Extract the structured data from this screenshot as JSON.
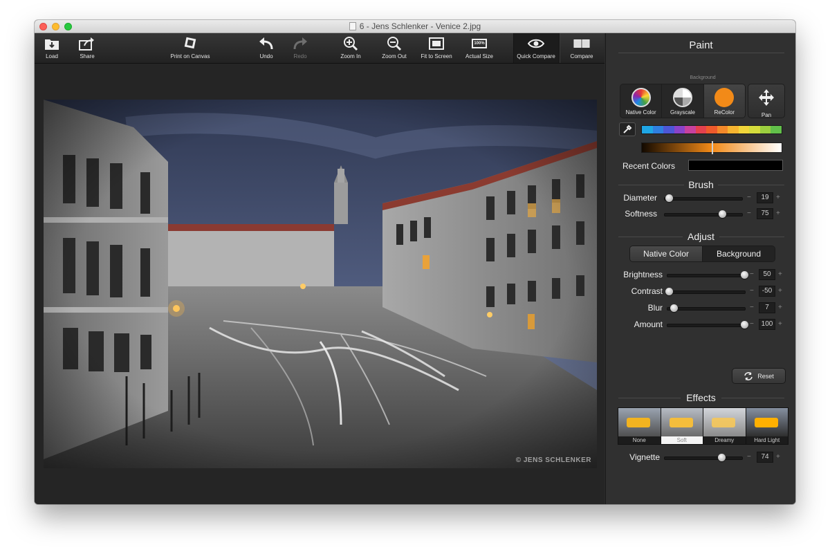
{
  "window": {
    "title": "6 - Jens Schlenker - Venice 2.jpg"
  },
  "toolbar": {
    "load": "Load",
    "share": "Share",
    "print_on_canvas": "Print on Canvas",
    "undo": "Undo",
    "redo": "Redo",
    "zoom_in": "Zoom In",
    "zoom_out": "Zoom Out",
    "fit_to_screen": "Fit to Screen",
    "actual_size": "Actual Size",
    "actual_size_badge": "100%",
    "quick_compare": "Quick Compare",
    "compare": "Compare"
  },
  "photo": {
    "watermark": "© JENS SCHLENKER"
  },
  "paint": {
    "title": "Paint",
    "background_caption": "Background",
    "modes": {
      "native_color": "Native Color",
      "grayscale": "Grayscale",
      "recolor": "ReColor",
      "pan": "Pan"
    },
    "active_mode": "recolor",
    "recolor_color": "#f28a18",
    "swatch_colors": [
      "#1fa6e5",
      "#2f7fe0",
      "#4d57d6",
      "#8a43c9",
      "#c7419e",
      "#e3414e",
      "#ee5a2c",
      "#f3892a",
      "#f6b430",
      "#f1d53a",
      "#d5dc3c",
      "#9ccf3f",
      "#62c04a"
    ],
    "shade_position": 0.5,
    "recent_colors_label": "Recent Colors"
  },
  "brush": {
    "title": "Brush",
    "diameter_label": "Diameter",
    "diameter_value": "19",
    "softness_label": "Softness",
    "softness_value": "75"
  },
  "adjust": {
    "title": "Adjust",
    "tab_native_color": "Native Color",
    "tab_background": "Background",
    "brightness_label": "Brightness",
    "brightness_value": "50",
    "contrast_label": "Contrast",
    "contrast_value": "-50",
    "blur_label": "Blur",
    "blur_value": "7",
    "amount_label": "Amount",
    "amount_value": "100",
    "reset": "Reset"
  },
  "effects": {
    "title": "Effects",
    "items": [
      "None",
      "Soft",
      "Dreamy",
      "Hard Light"
    ],
    "selected": "Soft",
    "vignette_label": "Vignette",
    "vignette_value": "74"
  },
  "controls": {
    "minus": "−",
    "plus": "+"
  }
}
